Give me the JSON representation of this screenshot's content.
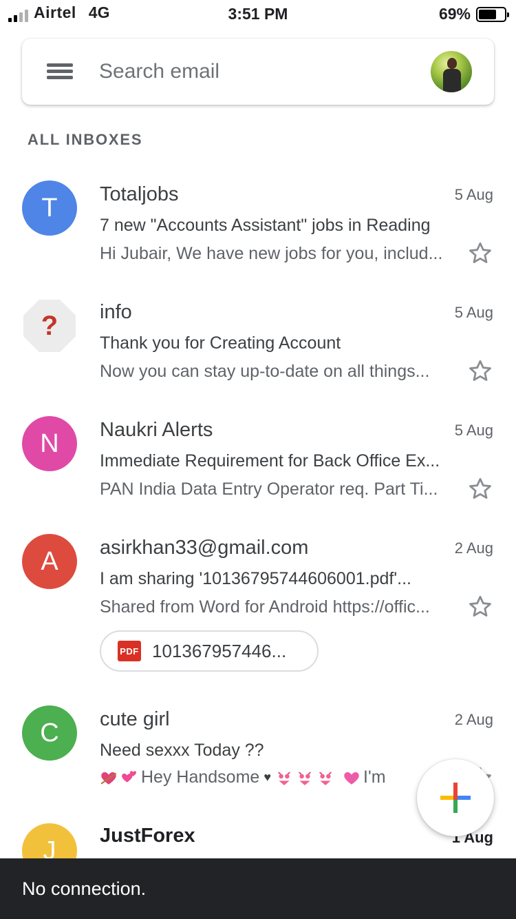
{
  "status_bar": {
    "carrier": "Airtel",
    "network": "4G",
    "time": "3:51 PM",
    "battery": "69%",
    "battery_level": 0.69,
    "signal_bars": 2
  },
  "search": {
    "placeholder": "Search email"
  },
  "section_label": "ALL INBOXES",
  "emails": [
    {
      "sender": "Totaljobs",
      "date": "5 Aug",
      "subject": "7 new \"Accounts Assistant\" jobs in Reading",
      "preview": "Hi Jubair, We have new jobs for you, includ...",
      "avatar_letter": "T",
      "avatar_color": "#4f85e6"
    },
    {
      "sender": "info",
      "date": "5 Aug",
      "subject": "Thank you for Creating Account",
      "preview": "Now you can stay up-to-date on all things...",
      "avatar_letter": "?",
      "avatar_color": "#ececec"
    },
    {
      "sender": "Naukri Alerts",
      "date": "5 Aug",
      "subject": "Immediate Requirement for Back Office Ex...",
      "preview": "PAN India Data Entry Operator req. Part Ti...",
      "avatar_letter": "N",
      "avatar_color": "#e04aa6"
    },
    {
      "sender": "asirkhan33@gmail.com",
      "date": "2 Aug",
      "subject": "I am sharing '10136795744606001.pdf'...",
      "preview": "Shared from Word for Android https://offic...",
      "avatar_letter": "A",
      "avatar_color": "#dd4b3e",
      "attachment": {
        "type_label": "PDF",
        "name": "101367957446..."
      }
    },
    {
      "sender": "cute girl",
      "date": "2 Aug",
      "subject": "Need sexxx Today ??",
      "preview": "Hey Handsome",
      "preview_tail": "I'm",
      "avatar_letter": "C",
      "avatar_color": "#4caf50"
    },
    {
      "sender": "JustForex",
      "date": "1 Aug",
      "avatar_letter": "J",
      "avatar_color": "#f2c13b"
    }
  ],
  "snackbar": {
    "message": "No connection."
  },
  "icons": {
    "menu": "menu-icon",
    "star": "star-outline-icon",
    "compose": "compose-plus-icon",
    "pdf": "pdf-icon"
  }
}
